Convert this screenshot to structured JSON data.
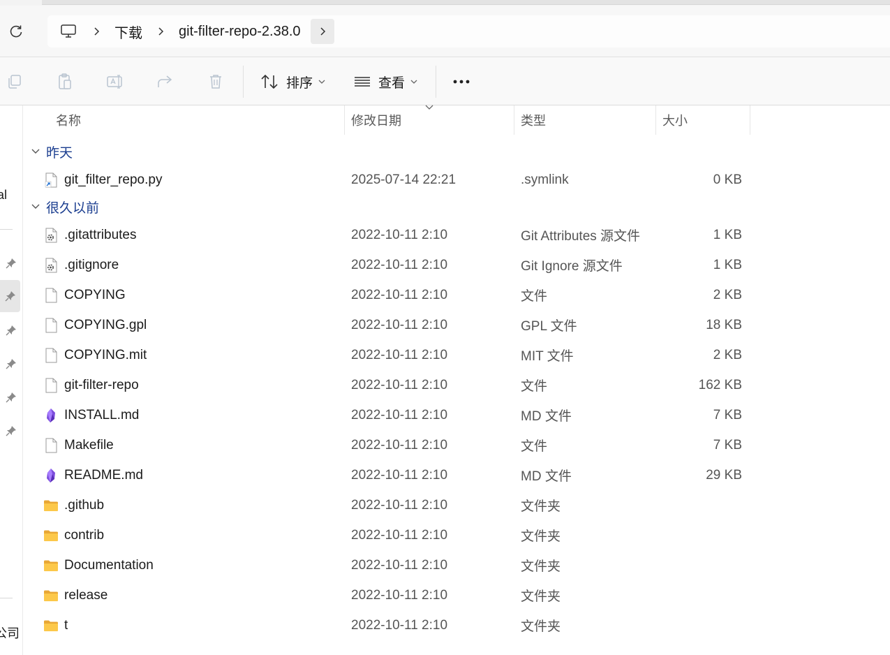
{
  "breadcrumb": {
    "items": [
      "下载",
      "git-filter-repo-2.38.0"
    ]
  },
  "toolbar": {
    "sort_label": "排序",
    "view_label": "查看"
  },
  "nav": {
    "fragment_top": "al",
    "fragment_bottom": "公司"
  },
  "columns": {
    "name": "名称",
    "date": "修改日期",
    "type": "类型",
    "size": "大小"
  },
  "groups": [
    {
      "label": "昨天",
      "files": [
        {
          "name": "git_filter_repo.py",
          "date": "2025-07-14 22:21",
          "type": ".symlink",
          "size": "0 KB",
          "icon": "shortcut-file-icon"
        }
      ]
    },
    {
      "label": "很久以前",
      "files": [
        {
          "name": ".gitattributes",
          "date": "2022-10-11 2:10",
          "type": "Git Attributes 源文件",
          "size": "1 KB",
          "icon": "config-file-icon"
        },
        {
          "name": ".gitignore",
          "date": "2022-10-11 2:10",
          "type": "Git Ignore 源文件",
          "size": "1 KB",
          "icon": "config-file-icon"
        },
        {
          "name": "COPYING",
          "date": "2022-10-11 2:10",
          "type": "文件",
          "size": "2 KB",
          "icon": "file-icon"
        },
        {
          "name": "COPYING.gpl",
          "date": "2022-10-11 2:10",
          "type": "GPL 文件",
          "size": "18 KB",
          "icon": "file-icon"
        },
        {
          "name": "COPYING.mit",
          "date": "2022-10-11 2:10",
          "type": "MIT 文件",
          "size": "2 KB",
          "icon": "file-icon"
        },
        {
          "name": "git-filter-repo",
          "date": "2022-10-11 2:10",
          "type": "文件",
          "size": "162 KB",
          "icon": "file-icon"
        },
        {
          "name": "INSTALL.md",
          "date": "2022-10-11 2:10",
          "type": "MD 文件",
          "size": "7 KB",
          "icon": "obsidian-icon"
        },
        {
          "name": "Makefile",
          "date": "2022-10-11 2:10",
          "type": "文件",
          "size": "7 KB",
          "icon": "file-icon"
        },
        {
          "name": "README.md",
          "date": "2022-10-11 2:10",
          "type": "MD 文件",
          "size": "29 KB",
          "icon": "obsidian-icon"
        },
        {
          "name": ".github",
          "date": "2022-10-11 2:10",
          "type": "文件夹",
          "size": "",
          "icon": "folder-icon"
        },
        {
          "name": "contrib",
          "date": "2022-10-11 2:10",
          "type": "文件夹",
          "size": "",
          "icon": "folder-icon"
        },
        {
          "name": "Documentation",
          "date": "2022-10-11 2:10",
          "type": "文件夹",
          "size": "",
          "icon": "folder-icon"
        },
        {
          "name": "release",
          "date": "2022-10-11 2:10",
          "type": "文件夹",
          "size": "",
          "icon": "folder-icon"
        },
        {
          "name": "t",
          "date": "2022-10-11 2:10",
          "type": "文件夹",
          "size": "",
          "icon": "folder-icon"
        }
      ]
    }
  ]
}
